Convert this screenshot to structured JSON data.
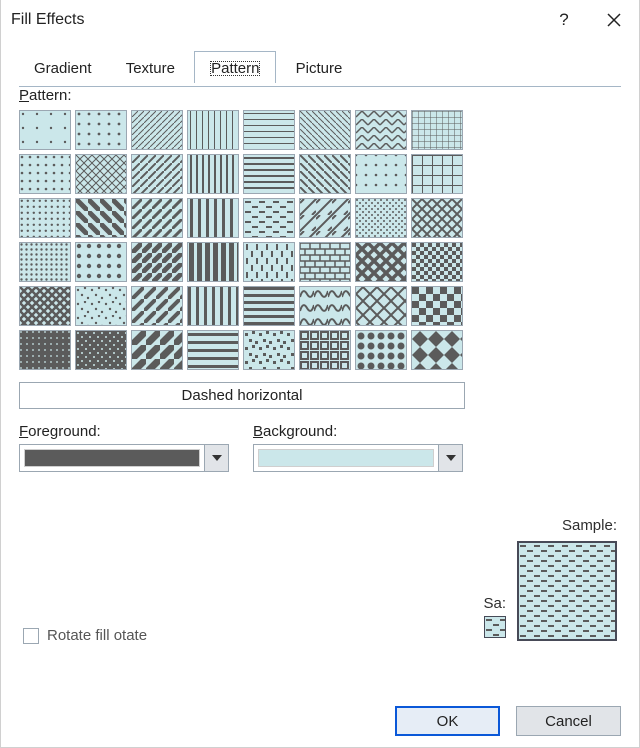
{
  "title": "Fill Effects",
  "tabs": {
    "gradient": "Gradient",
    "texture": "Texture",
    "pattern": "Pattern",
    "picture": "Picture"
  },
  "labels": {
    "pattern": "Pattern:",
    "foreground": "Foreground:",
    "background": "Background:",
    "sample": "Sample:",
    "sample_mini": "Sa:",
    "rotate": "Rotate fill otate"
  },
  "selected_pattern_name": "Dashed horizontal",
  "buttons": {
    "ok": "OK",
    "cancel": "Cancel"
  },
  "colors": {
    "foreground": "#5B5B5B",
    "background": "#cbe7ea"
  },
  "underline_idx": {
    "pattern": 0,
    "foreground": 0,
    "background": 0
  },
  "patterns": [
    "dots-5",
    "dots-10",
    "diag-lt-lt",
    "stripes-v-lt",
    "stripes-h-lt",
    "diag-rt-lt",
    "chevron",
    "grid-fine",
    "dots-20",
    "cross-hatch-lt",
    "diag-lt-md",
    "stripes-v-md",
    "stripes-h-md",
    "diag-rt-md",
    "grid-dots",
    "grid-md",
    "dots-30",
    "diag-rt-thick",
    "diag-lt-thick",
    "stripes-v-thick",
    "dashed-h",
    "diag-brick",
    "dots-tight",
    "diag-cross",
    "dots-40",
    "dots-lg",
    "diag-lt-bold",
    "stripes-v-bold",
    "dashed-v",
    "brick",
    "diag-cross-bold",
    "checker-sm",
    "cross-hatch-bold",
    "dots-scatter",
    "diag-lt-alt",
    "stripes-v-alt",
    "stripes-h-alt",
    "tumble",
    "diamond-outline",
    "checker-md",
    "dark-1",
    "dark-2",
    "diag-soft",
    "h-bars",
    "confetti",
    "boxes",
    "balls",
    "diamond-solid"
  ]
}
